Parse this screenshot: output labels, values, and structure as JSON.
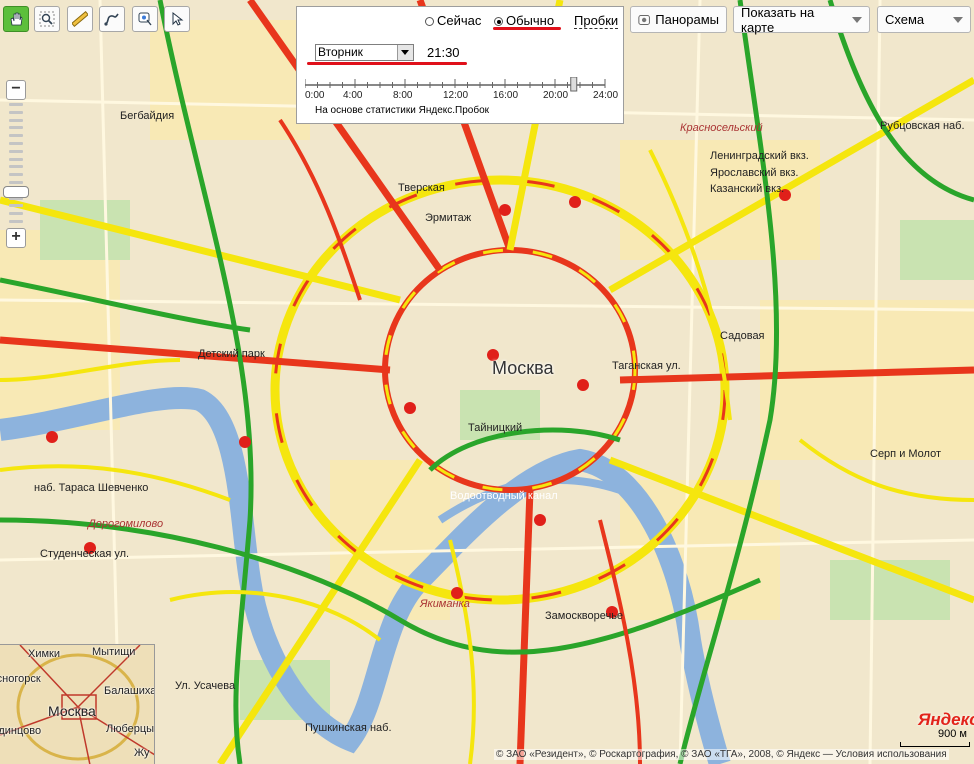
{
  "toolbar": {
    "tools": [
      {
        "name": "hand-icon",
        "active": true
      },
      {
        "name": "magnifier-icon",
        "active": false
      },
      {
        "name": "ruler-icon",
        "active": false
      },
      {
        "name": "route-icon",
        "active": false
      },
      {
        "name": "placemark-icon",
        "active": false
      },
      {
        "name": "pointer-icon",
        "active": false
      }
    ]
  },
  "traffic": {
    "now_label": "Сейчас",
    "usual_label": "Обычно",
    "usual_selected": true,
    "title": "Пробки",
    "day": "Вторник",
    "time": "21:30",
    "slider_ticks": [
      "0:00",
      "4:00",
      "8:00",
      "12:00",
      "16:00",
      "20:00",
      "24:00"
    ],
    "slider_value_hours": 21.5,
    "caption": "На основе статистики Яндекс.Пробок"
  },
  "controls": {
    "panoramas": "Панорамы",
    "show_on_map": "Показать на карте",
    "map_type": "Схема"
  },
  "map": {
    "city_label": "Москва",
    "labels": [
      "Красносельский",
      "Ленинградский вкз.",
      "Казанский вкз.",
      "Ярославский вкз.",
      "Тверская",
      "Эрмитаж",
      "Детский парк",
      "Таганская ул.",
      "Якиманка",
      "Замоскворечье",
      "Дорогомилово",
      "Студенческая ул.",
      "наб. Тараса Шевченко",
      "Пушкинская наб.",
      "Тайницкий",
      "Водоотводный канал",
      "Серп и Молот",
      "Бегбайдия",
      "Рубцовская наб.",
      "Ул. Усачева",
      "Садовая"
    ],
    "minimap_labels": [
      "Химки",
      "Мытищи",
      "Красногорск",
      "Москва",
      "Балашиха",
      "Люберцы",
      "Одинцово",
      "Жу"
    ],
    "copyright": "© ЗАО «Резидент», © Роскартография, © ЗАО «ТГА», 2008, © Яндекс — Условия использования",
    "scale": "900 м",
    "logo": "Яндекс"
  },
  "colors": {
    "traffic_green": "#2aa52a",
    "traffic_yellow": "#f5e60e",
    "traffic_red": "#e8361c",
    "annotation_red": "#e0101a"
  }
}
